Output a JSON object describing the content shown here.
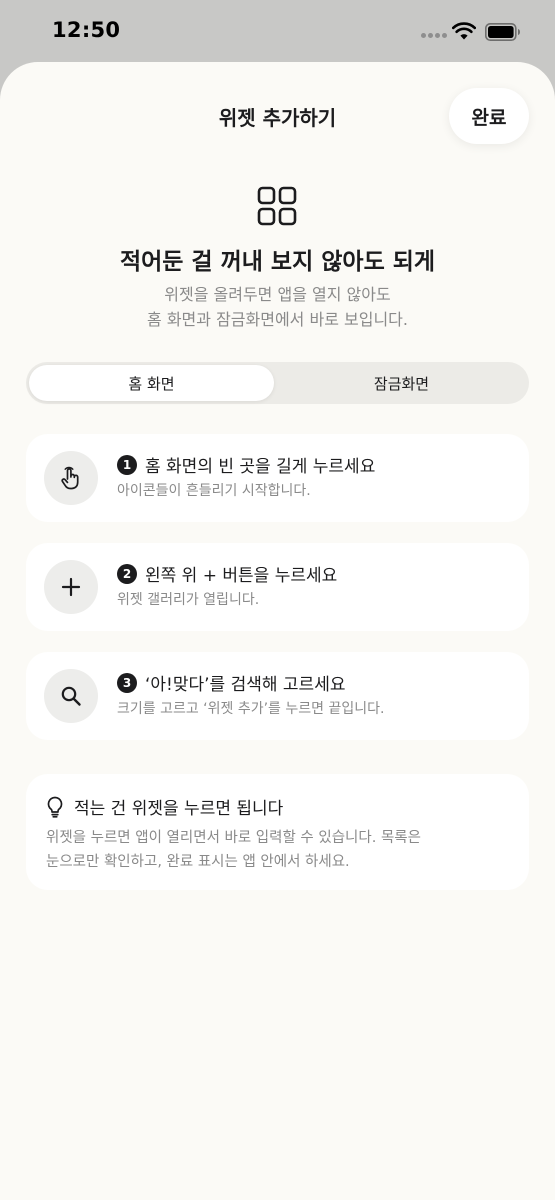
{
  "status_bar": {
    "time": "12:50"
  },
  "header": {
    "title": "위젯 추가하기",
    "done_label": "완료"
  },
  "hero": {
    "headline": "적어둔 걸 꺼내 보지 않아도 되게",
    "subtext_line1": "위젯을 올려두면 앱을 열지 않아도",
    "subtext_line2": "홈 화면과 잠금화면에서 바로 보입니다."
  },
  "segments": [
    {
      "label": "홈 화면",
      "selected": true
    },
    {
      "label": "잠금화면",
      "selected": false
    }
  ],
  "steps": [
    {
      "number": "1",
      "icon": "hand-tap-icon",
      "title": "홈 화면의 빈 곳을 길게 누르세요",
      "desc": "아이콘들이 흔들리기 시작합니다."
    },
    {
      "number": "2",
      "icon": "plus-icon",
      "title": "왼쪽 위 + 버튼을 누르세요",
      "desc": "위젯 갤러리가 열립니다."
    },
    {
      "number": "3",
      "icon": "search-icon",
      "title": "‘아!맞다’를 검색해 고르세요",
      "desc": "크기를 고르고 ‘위젯 추가’를 누르면 끝입니다."
    }
  ],
  "tip": {
    "icon": "lightbulb-icon",
    "title": "적는 건 위젯을 누르면 됩니다",
    "body_line1": "위젯을 누르면 앱이 열리면서 바로 입력할 수 있습니다. 목록은",
    "body_line2": "눈으로만 확인하고, 완료 표시는 앱 안에서 하세요."
  },
  "colors": {
    "sheet_background": "#fbfaf6",
    "card_background": "#ffffff",
    "secondary_text": "#8a8a8a"
  }
}
